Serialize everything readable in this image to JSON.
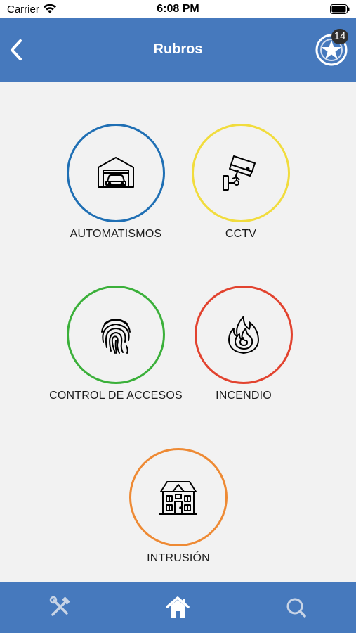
{
  "status_bar": {
    "carrier": "Carrier",
    "time": "6:08 PM"
  },
  "nav": {
    "title": "Rubros",
    "badge_count": "14",
    "back_icon": "chevron-left-icon",
    "badge_icon": "star-emblem-icon"
  },
  "categories": [
    {
      "label": "AUTOMATISMOS",
      "ring_color": "#1f6fb4",
      "icon": "garage-car-icon"
    },
    {
      "label": "CCTV",
      "ring_color": "#f1dc3d",
      "icon": "security-camera-icon"
    },
    {
      "label": "CONTROL DE ACCESOS",
      "ring_color": "#3bb03a",
      "icon": "fingerprint-icon"
    },
    {
      "label": "INCENDIO",
      "ring_color": "#e2432f",
      "icon": "fire-icon"
    },
    {
      "label": "INTRUSIÓN",
      "ring_color": "#ee8a34",
      "icon": "house-icon"
    }
  ],
  "tab_bar": {
    "tools_icon": "tools-icon",
    "home_icon": "home-icon",
    "search_icon": "search-icon"
  }
}
